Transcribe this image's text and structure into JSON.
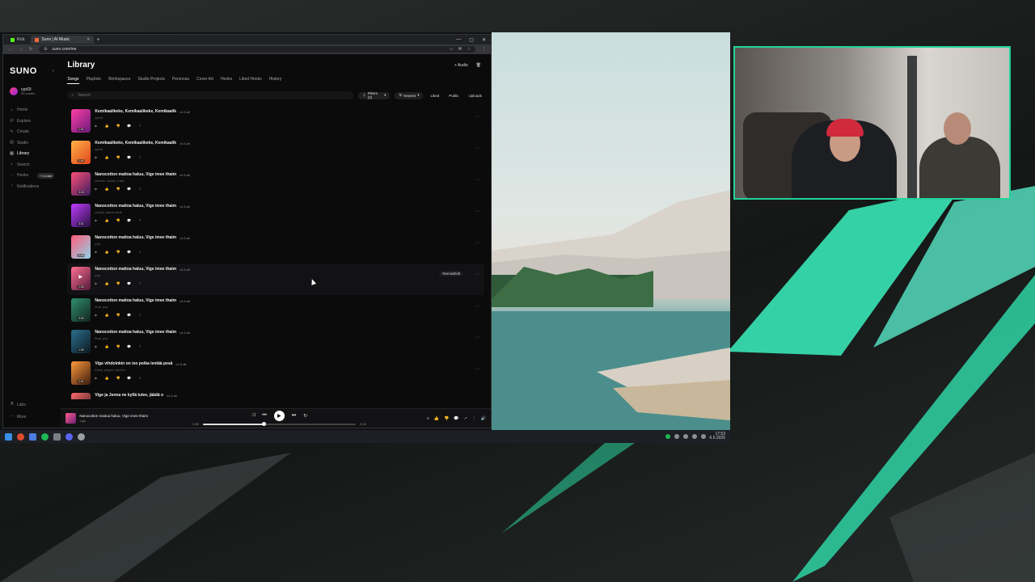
{
  "browser": {
    "tabs": [
      {
        "label": "Kick",
        "color": "#53fc18",
        "active": false
      },
      {
        "label": "Suno | AI Music",
        "color": "#ff6a3d",
        "active": true
      }
    ],
    "url": "suno.com/me"
  },
  "app": {
    "logo": "SUNO",
    "user": {
      "name": "ryp69",
      "credits": "50 credits"
    },
    "nav": [
      {
        "label": "Home",
        "icon": "home-icon",
        "active": false
      },
      {
        "label": "Explore",
        "icon": "compass-icon",
        "active": false
      },
      {
        "label": "Create",
        "icon": "pencil-icon",
        "active": false
      },
      {
        "label": "Studio",
        "icon": "studio-icon",
        "active": false
      },
      {
        "label": "Library",
        "icon": "library-icon",
        "active": true
      },
      {
        "label": "Search",
        "icon": "search-icon",
        "active": false
      },
      {
        "label": "Hooks",
        "icon": "hook-icon",
        "active": false,
        "pill": "+ Create"
      },
      {
        "label": "Notifications",
        "icon": "bell-icon",
        "active": false
      }
    ],
    "bottom_nav": [
      {
        "label": "Labs",
        "icon": "flask-icon"
      },
      {
        "label": "More",
        "icon": "more-icon"
      }
    ]
  },
  "library": {
    "title": "Library",
    "upload_label": "+ Audio",
    "tabs": [
      "Songs",
      "Playlists",
      "Workspaces",
      "Studio Projects",
      "Personas",
      "Cover Art",
      "Hooks",
      "Liked Hooks",
      "History"
    ],
    "active_tab": "Songs",
    "search_placeholder": "Search",
    "filters_label": "Filters (3)",
    "sort_label": "Newest",
    "quick_filters": [
      "Liked",
      "Public",
      "Uploads"
    ]
  },
  "songs": [
    {
      "title": "Kemikaalikeke, Kemikaalikeke, Kemikaalik",
      "version": "v4.5-all",
      "tags": "synth",
      "duration": "1:41",
      "colors": [
        "#ff3ea5",
        "#6a1b7a"
      ]
    },
    {
      "title": "Kemikaalikeke, Kemikaalikeke, Kemikaalik",
      "version": "v4.5-all",
      "tags": "synth",
      "duration": "1:41",
      "colors": [
        "#ffb347",
        "#e0451b"
      ]
    },
    {
      "title": "Nanocotton maitoa haluu, Vige imee thaim",
      "version": "v4.5-all",
      "tags": "electric, dance, trash",
      "duration": "3:03",
      "colors": [
        "#ff4f7a",
        "#3a1d5c"
      ]
    },
    {
      "title": "Nanocotton maitoa haluu, Vige imee thaim",
      "version": "v4.5-all",
      "tags": "catchy, dance beat",
      "duration": "3:01",
      "colors": [
        "#c03cff",
        "#26113f"
      ]
    },
    {
      "title": "Nanocotton maitoa haluu, Vige imee thaim",
      "version": "v4.5-all",
      "tags": "pop",
      "duration": "2:44",
      "colors": [
        "#ff5d7a",
        "#8fd3e8"
      ]
    },
    {
      "title": "Nanocotton maitoa haluu, Vige imee thaim",
      "version": "v4.5-all",
      "tags": "pop",
      "duration": "1:26",
      "colors": [
        "#ff6f91",
        "#541a3a"
      ],
      "hover": true,
      "remix_label": "Remix/Edit"
    },
    {
      "title": "Nanocotton maitoa haluu, Vige imee thaim",
      "version": "v4.5-all",
      "tags": "final, pop",
      "duration": "3:03",
      "colors": [
        "#2f8f6f",
        "#12251f"
      ]
    },
    {
      "title": "Nanocotton maitoa haluu, Vige imee thaim",
      "version": "v4.5-all",
      "tags": "final, pop",
      "duration": "1:00",
      "colors": [
        "#2b6f8f",
        "#0d1a22"
      ]
    },
    {
      "title": "Vige vihdoinkin on iso poika lentää pesä",
      "version": "v4.5-all",
      "tags": "funny, playful, techno",
      "duration": "1:41",
      "colors": [
        "#ff9a3c",
        "#3b1a0e"
      ]
    },
    {
      "title": "Vige ja Jenna ne kyllä tulee, jäädä o",
      "version": "v4.5-all",
      "tags": "",
      "duration": "",
      "colors": [
        "#ff6b6b",
        "#2a1a1a"
      ]
    }
  ],
  "player": {
    "title": "Nanocotton maitoa haluu, Vige imee thaim",
    "artist": "Vige",
    "elapsed": "1:05",
    "total": "2:44",
    "progress": 0.4
  },
  "taskbar": {
    "time": "17:53",
    "date": "6.5.2025"
  },
  "colors": {
    "accent": "#22d39a",
    "background": "#0b0b0c"
  }
}
